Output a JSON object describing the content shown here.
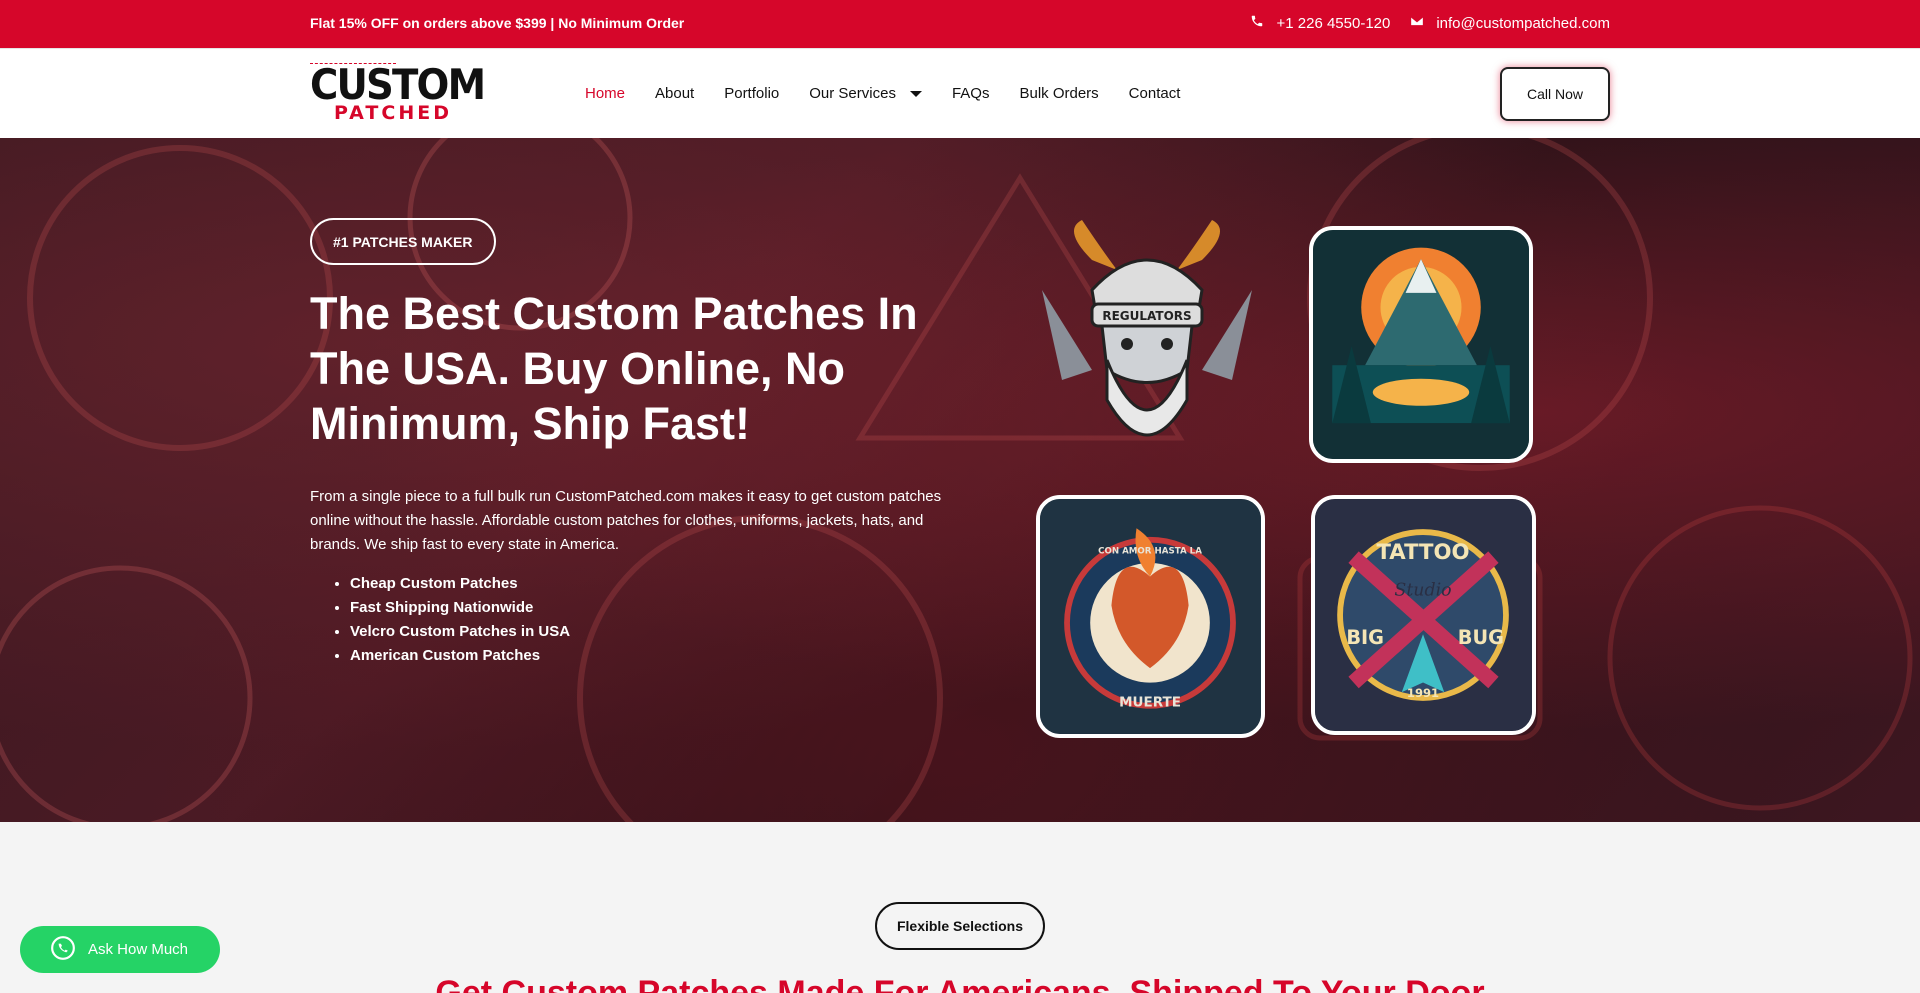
{
  "topbar": {
    "promo": "Flat 15% OFF on orders above $399 | No Minimum Order",
    "phone": "+1 226 4550-120",
    "email": "info@custompatched.com",
    "phone_icon": "phone-icon",
    "email_icon": "envelope-icon"
  },
  "header": {
    "logo_top": "CUSTOM",
    "logo_bottom": "PATCHED",
    "nav": [
      "Home",
      "About",
      "Portfolio",
      "Our Services",
      "FAQs",
      "Bulk Orders",
      "Contact"
    ],
    "active": "Home",
    "call_now": "Call Now"
  },
  "hero": {
    "badge": "#1 PATCHES MAKER",
    "title": "The Best Custom Patches In The USA. Buy Online, No Minimum, Ship Fast!",
    "description": "From a single piece to a full bulk run  CustomPatched.com makes it easy to get custom patches online without the hassle. Affordable custom patches for clothes, uniforms, jackets, hats, and brands. We ship fast to every state in America.",
    "bullets": [
      "Cheap Custom Patches",
      "Fast Shipping Nationwide",
      "Velcro Custom Patches in USA",
      "American Custom Patches"
    ],
    "patch1_text": "REGULATORS",
    "patch3_top": "CON AMOR HASTA LA",
    "patch3_bottom": "MUERTE",
    "patch4_top": "TATTOO",
    "patch4_mid": "Studio",
    "patch4_left": "BIG",
    "patch4_right": "BUG",
    "patch4_year": "1991"
  },
  "section2": {
    "pill": "Flexible Selections",
    "heading": "Get Custom Patches Made For Americans, Shipped To Your Door"
  },
  "whatsapp": {
    "label": "Ask How Much",
    "icon": "whatsapp-icon"
  },
  "colors": {
    "brand_red": "#d6062a",
    "whatsapp_green": "#25d366"
  }
}
